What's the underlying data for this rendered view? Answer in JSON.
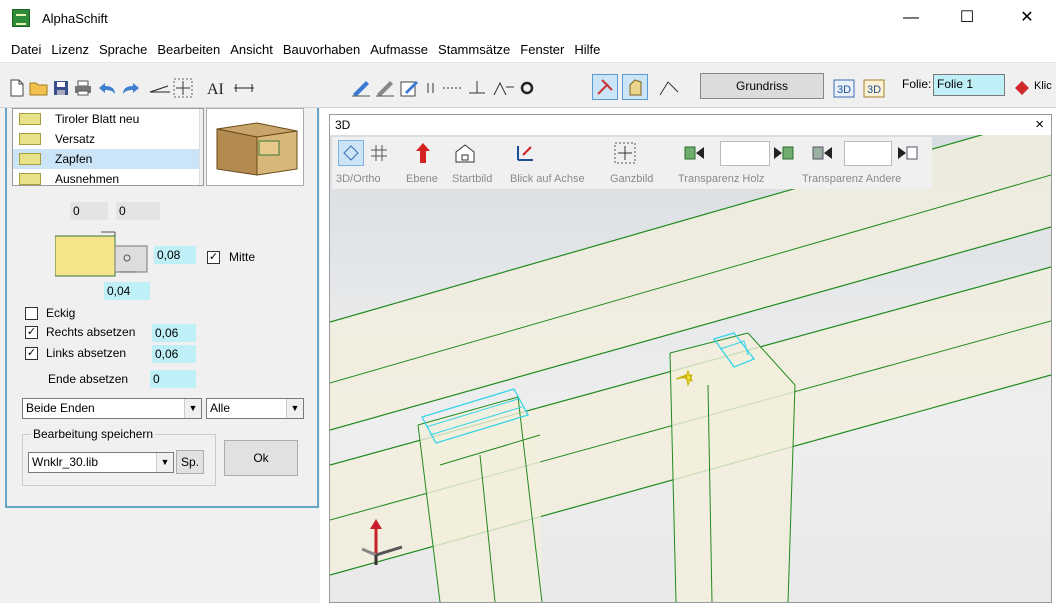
{
  "app": {
    "title": "AlphaSchift"
  },
  "window_controls": {
    "minimize": "—",
    "maximize": "☐",
    "close": "✕"
  },
  "menu": [
    "Datei",
    "Lizenz",
    "Sprache",
    "Bearbeiten",
    "Ansicht",
    "Bauvorhaben",
    "Aufmasse",
    "Stammsätze",
    "Fenster",
    "Hilfe"
  ],
  "toolbar": {
    "grundriss_label": "Grundriss",
    "folie_label": "Folie:",
    "folie_value": "Folie 1",
    "clip_label": "Klic"
  },
  "left_panel": {
    "list_items": [
      "Tiroler Blatt neu",
      "Versatz",
      "Zapfen",
      "Ausnehmen"
    ],
    "selected_index": 2,
    "top_values": [
      "0",
      "0"
    ],
    "right_value": "0,08",
    "bottom_value": "0,04",
    "mitte_label": "Mitte",
    "mitte_checked": true,
    "eckig_label": "Eckig",
    "eckig_checked": false,
    "rechts_label": "Rechts absetzen",
    "rechts_checked": true,
    "rechts_value": "0,06",
    "links_label": "Links absetzen",
    "links_checked": true,
    "links_value": "0,06",
    "ende_label": "Ende absetzen",
    "ende_value": "0",
    "ends_select": "Beide Enden",
    "scope_select": "Alle",
    "save_group_title": "Bearbeitung speichern",
    "save_file": "Wnklr_30.lib",
    "sp_button": "Sp.",
    "ok_button": "Ok"
  },
  "view3d": {
    "title": "3D",
    "close": "×",
    "buttons": {
      "ortho": "3D/Ortho",
      "ebene": "Ebene",
      "startbild": "Startbild",
      "achse": "Blick auf Achse",
      "ganzbild": "Ganzbild",
      "transp_holz": "Transparenz Holz",
      "transp_andere": "Transparenz Andere"
    }
  },
  "colors": {
    "wood": "#f3efdc",
    "wood_edge": "#1f8a1f",
    "highlight": "#36d4e8",
    "accent_field": "#bff0f7",
    "panel_border": "#66a6c9"
  }
}
